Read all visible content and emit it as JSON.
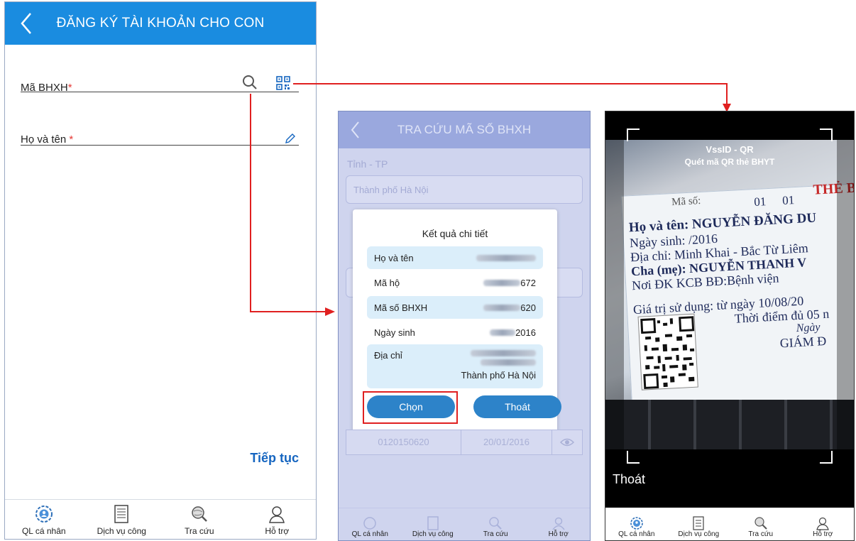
{
  "panel1": {
    "title": "ĐĂNG KÝ TÀI KHOẢN CHO CON",
    "bhxh_label": "Mã BHXH",
    "name_label": "Họ và tên ",
    "required_mark": "*",
    "next_label": "Tiếp tục",
    "tabs": [
      {
        "label": "QL cá nhân",
        "icon": "person-gear-icon"
      },
      {
        "label": "Dịch vụ công",
        "icon": "document-icon"
      },
      {
        "label": "Tra cứu",
        "icon": "globe-search-icon"
      },
      {
        "label": "Hỗ trợ",
        "icon": "support-person-icon"
      }
    ]
  },
  "panel2": {
    "title": "TRA CỨU MÃ SỐ BHXH",
    "province_label": "Tỉnh - TP",
    "province_value": "Thành phố Hà Nội",
    "dialog": {
      "title": "Kết quả chi tiết",
      "rows": [
        {
          "label": "Họ và tên",
          "value": ""
        },
        {
          "label": "Mã hộ",
          "value": "672"
        },
        {
          "label": "Mã số BHXH",
          "value": "620"
        },
        {
          "label": "Ngày sinh",
          "value": "2016"
        },
        {
          "label": "Địa chỉ",
          "value": "Thành phố Hà Nội"
        }
      ],
      "choose_button": "Chọn",
      "exit_button": "Thoát"
    },
    "table_row": {
      "code": "0120150620",
      "date": "20/01/2016"
    },
    "tabs": [
      "QL cá nhân",
      "Dịch vụ công",
      "Tra cứu",
      "Hỗ trợ"
    ]
  },
  "panel3": {
    "title": "VssID - QR",
    "subtitle": "Quét mã QR thẻ BHYT",
    "exit_label": "Thoát",
    "card": {
      "l0": "Mã số:",
      "l1": "Họ và tên:  NGUYỄN ĐĂNG DU",
      "l2": "Ngày sinh:        /2016",
      "l3": "Địa chỉ: Minh Khai - Bắc Từ Liêm",
      "l4": "Cha (mẹ):  NGUYỄN THANH V",
      "l5": "Nơi ĐK KCB BĐ:Bệnh viện",
      "l6": "Giá trị sử dụng: từ ngày  10/08/20",
      "l7": "Thời điểm đủ 05 n",
      "l8": "Ngày",
      "l9": "GIÁM Đ",
      "top_right": "THẺ BẢ",
      "code_parts": [
        "01",
        "01"
      ]
    },
    "tabs": [
      "QL cá nhân",
      "Dịch vụ công",
      "Tra cứu",
      "Hỗ trợ"
    ]
  },
  "colors": {
    "header_blue": "#1a8ce0",
    "link_blue": "#1565c0",
    "arrow_red": "#e02020",
    "button_blue": "#2d83c9"
  }
}
